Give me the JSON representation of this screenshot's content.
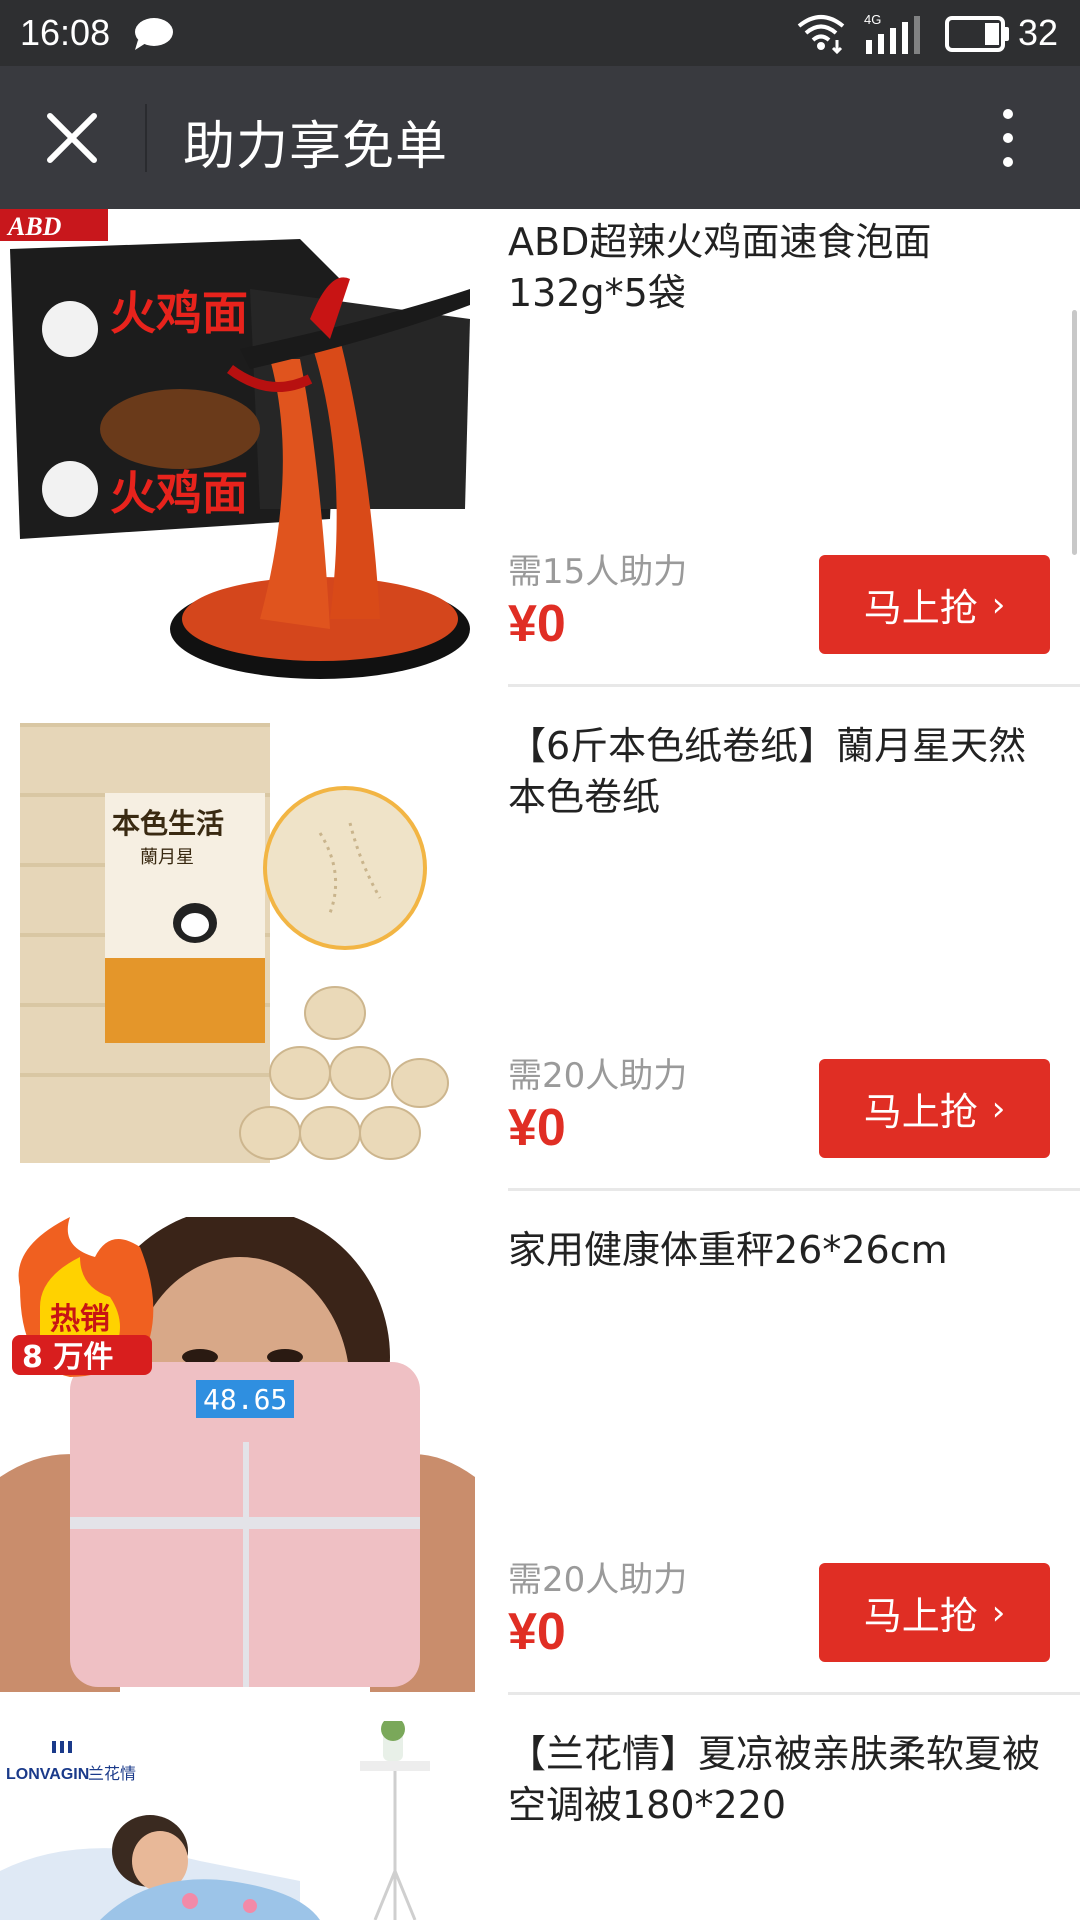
{
  "status_bar": {
    "time": "16:08",
    "network": "4G",
    "battery": "32",
    "icons": [
      "chat-icon",
      "wifi-icon",
      "signal-icon",
      "battery-icon"
    ]
  },
  "title_bar": {
    "title": "助力享免单",
    "close_icon": "close-icon",
    "more_icon": "more-vertical-icon"
  },
  "products": [
    {
      "name": "ABD超辣火鸡面速食泡面132g*5袋",
      "need": "需15人助力",
      "price": "¥0",
      "button": "马上抢"
    },
    {
      "name": "【6斤本色纸卷纸】蘭月星天然本色卷纸",
      "need": "需20人助力",
      "price": "¥0",
      "button": "马上抢"
    },
    {
      "name": "家用健康体重秤26*26cm",
      "need": "需20人助力",
      "price": "¥0",
      "button": "马上抢"
    },
    {
      "name": "【兰花情】夏凉被亲肤柔软夏被空调被180*220"
    }
  ],
  "images": {
    "noodle": {
      "brand": "ABD",
      "label": "火鸡面"
    },
    "tissue": {
      "label": "本色生活",
      "sub": "蘭月星"
    },
    "scale": {
      "badge_top": "热销",
      "badge_bottom": "8 万件",
      "display": "48.65"
    },
    "quilt": {
      "brand": "LONVAGIN",
      "brand_cn": "兰花情"
    }
  },
  "colors": {
    "accent": "#e02e24",
    "titlebar": "#393a3f",
    "statusbar": "#2e2f31"
  }
}
